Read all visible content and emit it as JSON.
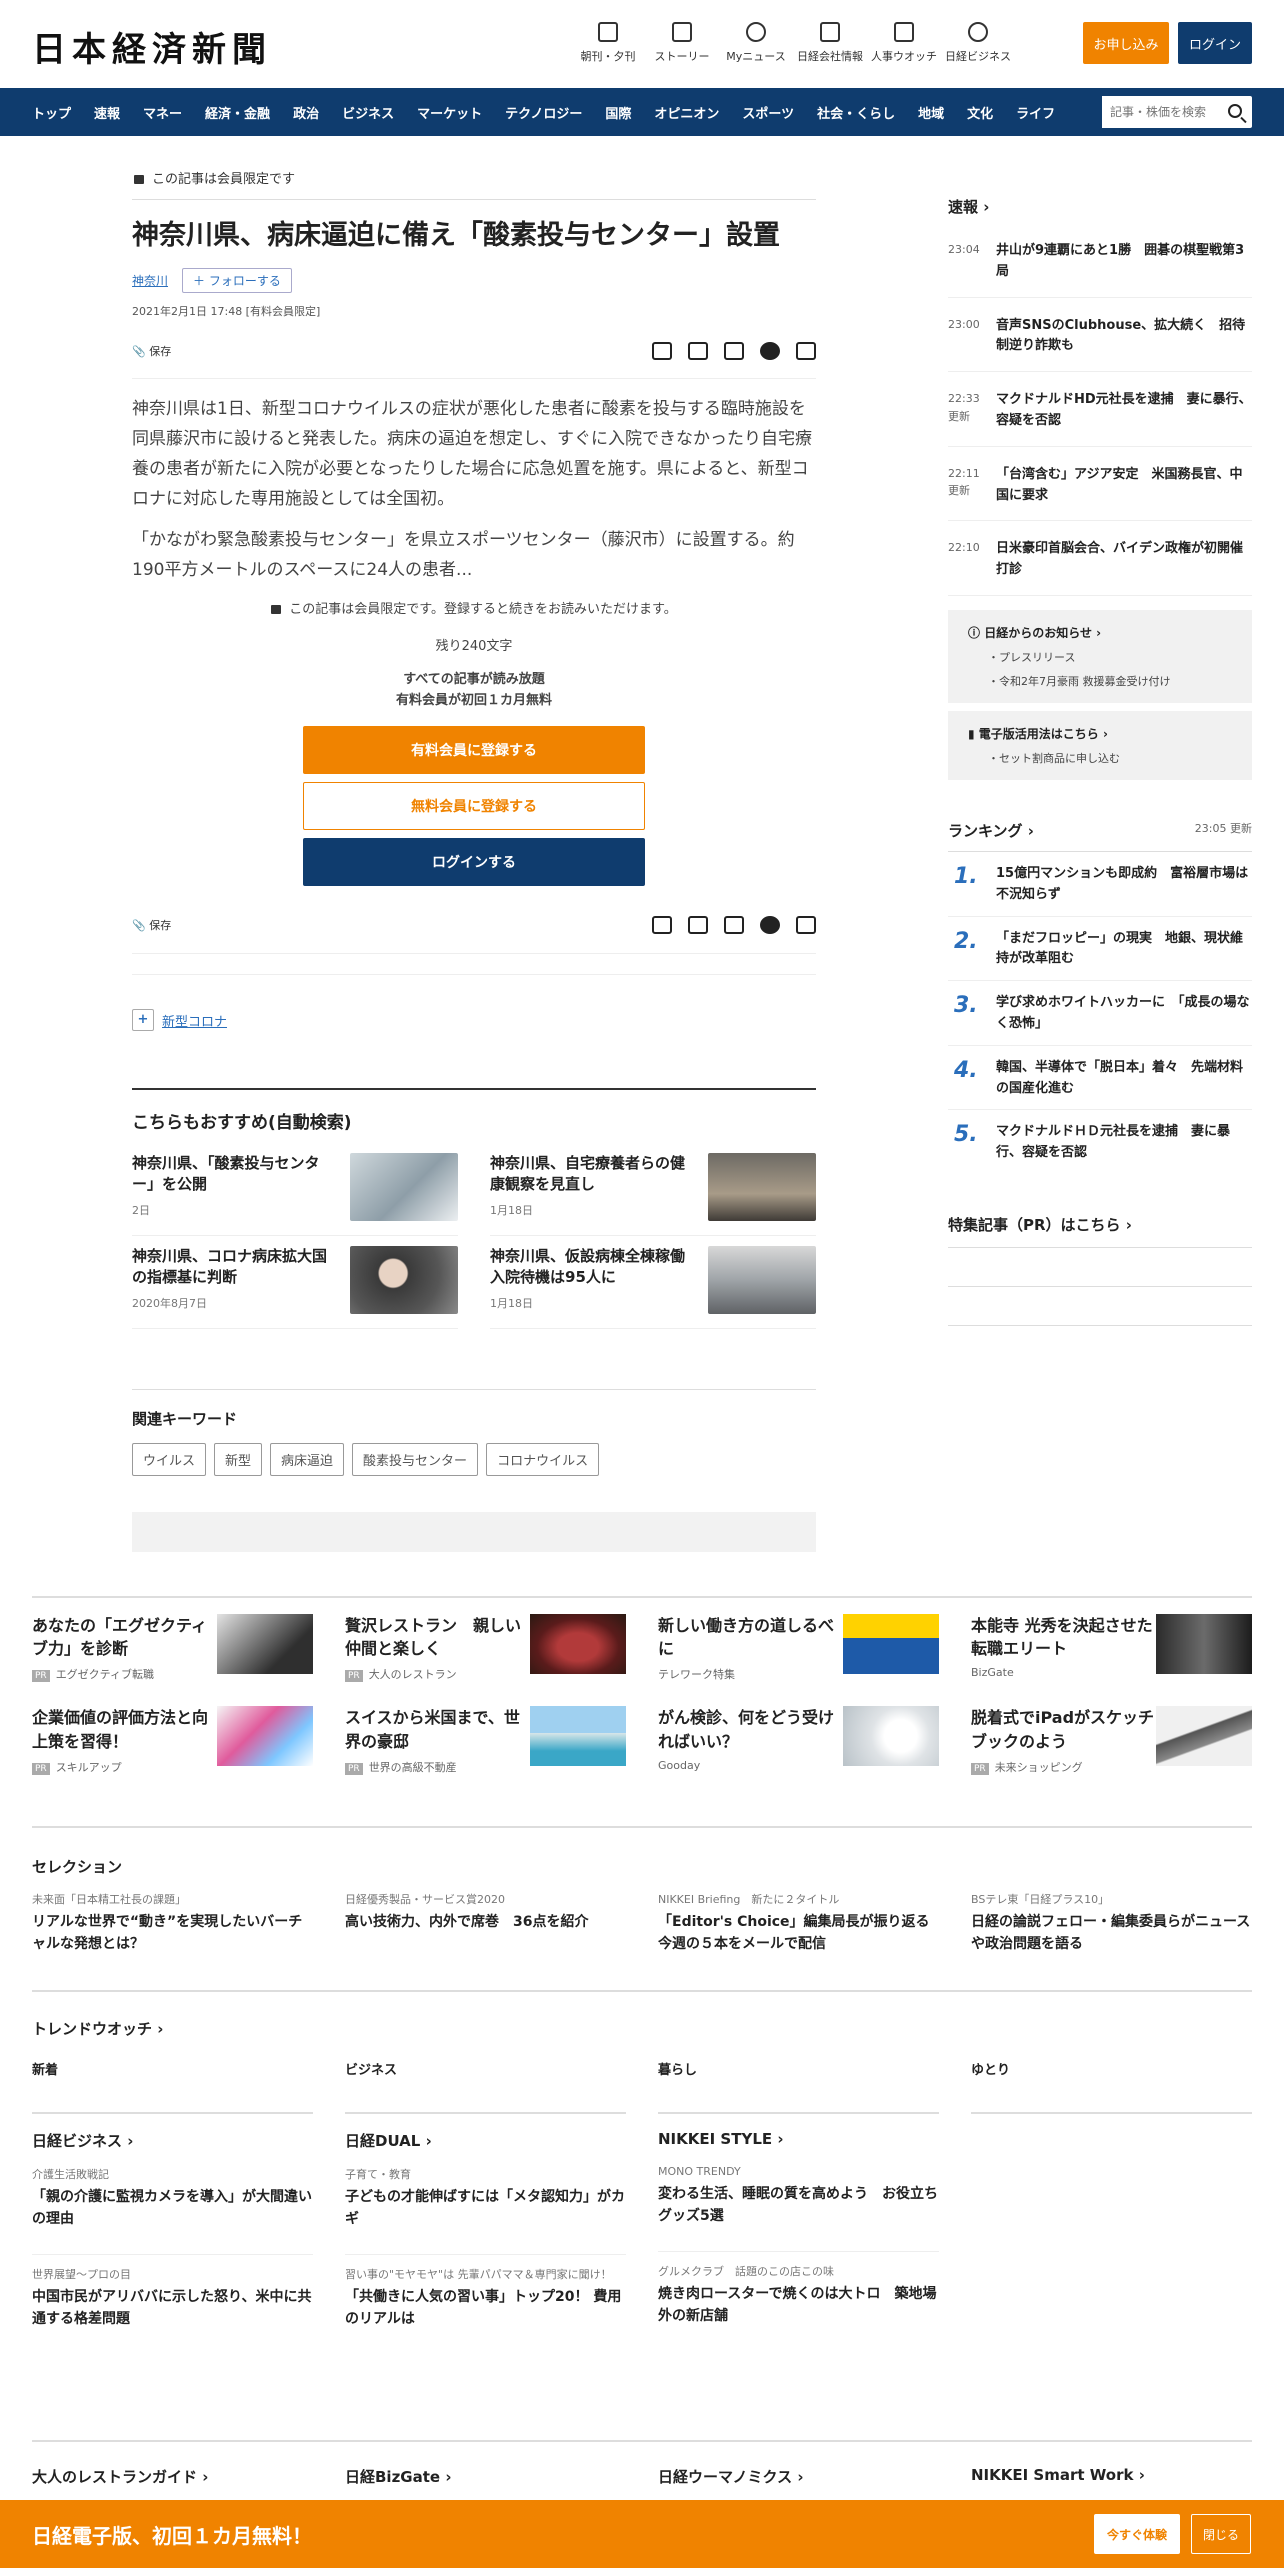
{
  "header": {
    "logo": "日本経済新聞",
    "icons": [
      {
        "name": "newspaper",
        "label": "朝刊・夕刊"
      },
      {
        "name": "story",
        "label": "ストーリー"
      },
      {
        "name": "user",
        "label": "Myニュース"
      },
      {
        "name": "chart",
        "label": "日経会社情報"
      },
      {
        "name": "search-person",
        "label": "人事ウオッチ"
      },
      {
        "name": "compass",
        "label": "日経ビジネス"
      }
    ],
    "subscribe": "お申し込み",
    "login": "ログイン"
  },
  "nav": {
    "items": [
      "トップ",
      "速報",
      "マネー",
      "経済・金融",
      "政治",
      "ビジネス",
      "マーケット",
      "テクノロジー",
      "国際",
      "オピニオン",
      "スポーツ",
      "社会・くらし",
      "地域",
      "文化",
      "ライフ"
    ],
    "search_placeholder": "記事・株価を検索"
  },
  "article": {
    "member_label": "この記事は会員限定です",
    "title": "神奈川県、病床逼迫に備え「酸素投与センター」設置",
    "tag": "神奈川",
    "follow": "フォローする",
    "date": "2021年2月1日 17:48 [有料会員限定]",
    "save": "保存",
    "p1": "神奈川県は1日、新型コロナウイルスの症状が悪化した患者に酸素を投与する臨時施設を同県藤沢市に設けると発表した。病床の逼迫を想定し、すぐに入院できなかったり自宅療養の患者が新たに入院が必要となったりした場合に応急処置を施す。県によると、新型コロナに対応した専用施設としては全国初。",
    "p2": "「かながわ緊急酸素投与センター」を県立スポーツセンター（藤沢市）に設置する。約190平方メートルのスペースに24人の患者...",
    "paywall_note": "この記事は会員限定です。登録すると続きをお読みいただけます。",
    "remaining": "残り240文字",
    "promo1": "すべての記事が読み放題",
    "promo2": "有料会員が初回１カ月無料",
    "cta_paid": "有料会員に登録する",
    "cta_free": "無料会員に登録する",
    "cta_login": "ログインする",
    "keyword": "新型コロナ"
  },
  "reco": {
    "title": "こちらもおすすめ(自動検索)",
    "items": [
      {
        "title": "神奈川県、「酸素投与センター」を公開",
        "date": "2日"
      },
      {
        "title": "神奈川県、自宅療養者らの健康観察を見直し",
        "date": "1月18日"
      },
      {
        "title": "神奈川県、コロナ病床拡大国の指標基に判断",
        "date": "2020年8月7日"
      },
      {
        "title": "神奈川県、仮設病棟全棟稼働　入院待機は95人に",
        "date": "1月18日"
      }
    ]
  },
  "related": {
    "title": "関連キーワード",
    "keywords": [
      "ウイルス",
      "新型",
      "病床逼迫",
      "酸素投与センター",
      "コロナウイルス"
    ]
  },
  "side": {
    "news_title": "速報",
    "news": [
      {
        "time": "23:04",
        "label": "",
        "text": "井山が9連覇にあと1勝　囲碁の棋聖戦第3局"
      },
      {
        "time": "23:00",
        "label": "",
        "text": "音声SNSのClubhouse、拡大続く　招待制逆り詐欺も"
      },
      {
        "time": "22:33",
        "label": "更新",
        "text": "マクドナルドHD元社長を逮捕　妻に暴行、容疑を否認"
      },
      {
        "time": "22:11",
        "label": "更新",
        "text": "「台湾含む」アジア安定　米国務長官、中国に要求"
      },
      {
        "time": "22:10",
        "label": "",
        "text": "日米豪印首脳会合、バイデン政権が初開催打診"
      }
    ],
    "notice1_title": "日経からのお知らせ",
    "notice1_items": [
      "プレスリリース",
      "令和2年7月豪雨 救援募金受け付け"
    ],
    "notice2_title": "電子版活用法はこちら",
    "notice2_items": [
      "セット割商品に申し込む"
    ],
    "ranking_title": "ランキング",
    "ranking_time": "23:05  更新",
    "ranking": [
      {
        "n": "1.",
        "text": "15億円マンションも即成約　富裕層市場は不況知らず"
      },
      {
        "n": "2.",
        "text": "「まだフロッピー」の現実　地銀、現状維持が改革阻む"
      },
      {
        "n": "3.",
        "text": "学び求めホワイトハッカーに　「成長の場なく恐怖」"
      },
      {
        "n": "4.",
        "text": "韓国、半導体で「脱日本」着々　先端材料の国産化進む"
      },
      {
        "n": "5.",
        "text": "マクドナルドＨＤ元社長を逮捕　妻に暴行、容疑を否認"
      }
    ],
    "pr_title": "特集記事（PR）はこちら"
  },
  "ads": [
    {
      "title": "あなたの「エグゼクティブ力」を診断",
      "source": "エグゼクティブ転職",
      "pr": "PR"
    },
    {
      "title": "贅沢レストラン　親しい仲間と楽しく",
      "source": "大人のレストラン",
      "pr": "PR"
    },
    {
      "title": "新しい働き方の道しるべに",
      "source": "テレワーク特集",
      "pr": ""
    },
    {
      "title": "本能寺 光秀を決起させた転職エリート",
      "source": "BizGate",
      "pr": ""
    },
    {
      "title": "企業価値の評価方法と向上策を習得！",
      "source": "スキルアップ",
      "pr": "PR"
    },
    {
      "title": "スイスから米国まで、世界の豪邸",
      "source": "世界の高級不動産",
      "pr": "PR"
    },
    {
      "title": "がん検診、何をどう受ければいい？",
      "source": "Gooday",
      "pr": ""
    },
    {
      "title": "脱着式でiPadがスケッチブックのよう",
      "source": "未来ショッピング",
      "pr": "PR"
    }
  ],
  "selection": {
    "title": "セレクション",
    "items": [
      {
        "meta": "未来面「日本精工社長の課題」",
        "title": "リアルな世界で“動き”を実現したいバーチャルな発想とは？"
      },
      {
        "meta": "日経優秀製品・サービス賞2020",
        "title": "高い技術力、内外で席巻　36点を紹介"
      },
      {
        "meta": "NIKKEI Briefing　新たに２タイトル",
        "title": "「Editor's Choice」編集局長が振り返る今週の５本をメールで配信"
      },
      {
        "meta": "BSテレ東「日経プラス10」",
        "title": "日経の論説フェロー・編集委員らがニュースや政治問題を語る"
      }
    ]
  },
  "trend": {
    "title": "トレンドウオッチ",
    "cols": [
      "新着",
      "ビジネス",
      "暮らし",
      "ゆとり"
    ]
  },
  "media": [
    {
      "title": "日経ビジネス",
      "items": [
        {
          "meta": "介護生活敗戦記",
          "title": "「親の介護に監視カメラを導入」が大間違いの理由"
        },
        {
          "meta": "世界展望～プロの目",
          "title": "中国市民がアリババに示した怒り、米中に共通する格差問題"
        }
      ]
    },
    {
      "title": "日経DUAL",
      "items": [
        {
          "meta": "子育て・教育",
          "title": "子どもの才能伸ばすには「メタ認知力」がカギ"
        },
        {
          "meta": "習い事の\"モヤモヤ\"は 先輩パパママ＆専門家に聞け！",
          "title": "「共働きに人気の習い事」トップ20！ 費用のリアルは"
        }
      ]
    },
    {
      "title": "NIKKEI STYLE",
      "items": [
        {
          "meta": "MONO TRENDY",
          "title": "変わる生活、睡眠の質を高めよう　お役立ちグッズ5選"
        },
        {
          "meta": "グルメクラブ　話題のこの店この味",
          "title": "焼き肉ロースターで焼くのは大トロ　築地場外の新店舗"
        }
      ]
    }
  ],
  "footer_links": [
    "大人のレストランガイド",
    "日経BizGate",
    "日経ウーマノミクス",
    "NIKKEI Smart Work"
  ],
  "banner": {
    "text": "日経電子版、初回１カ月無料！",
    "try": "今すぐ体験",
    "close": "閉じる"
  },
  "colors": {
    "navy": "#0f3c6e",
    "orange": "#f08300",
    "link": "#2a6ebb"
  }
}
